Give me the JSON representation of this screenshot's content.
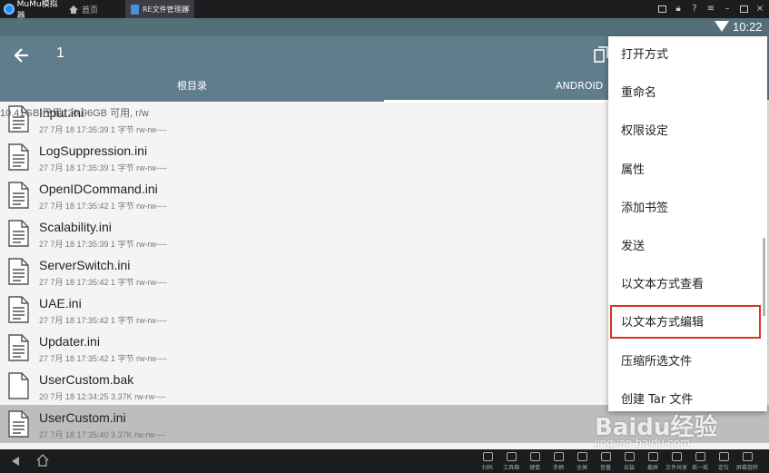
{
  "emulator": {
    "app_name": "MuMu模拟器",
    "home_tab": "首页",
    "active_tab": "RE文件管理器",
    "close_glyph": "×"
  },
  "status": {
    "time": "10:22"
  },
  "appbar": {
    "path": "1",
    "tab_root": "根目录",
    "tab_android": "ANDROID"
  },
  "storage_info": "10.41GB 已用, 20.96GB 可用, r/w",
  "files": [
    {
      "name": "Input.ini",
      "meta": "27 7月 18 17:35:39  1 字节  rw-rw----"
    },
    {
      "name": "LogSuppression.ini",
      "meta": "27 7月 18 17:35:39  1 字节  rw-rw----"
    },
    {
      "name": "OpenIDCommand.ini",
      "meta": "27 7月 18 17:35:42  1 字节  rw-rw----"
    },
    {
      "name": "Scalability.ini",
      "meta": "27 7月 18 17:35:39  1 字节  rw-rw----"
    },
    {
      "name": "ServerSwitch.ini",
      "meta": "27 7月 18 17:35:42  1 字节  rw-rw----"
    },
    {
      "name": "UAE.ini",
      "meta": "27 7月 18 17:35:42  1 字节  rw-rw----"
    },
    {
      "name": "Updater.ini",
      "meta": "27 7月 18 17:35:42  1 字节  rw-rw----"
    },
    {
      "name": "UserCustom.bak",
      "meta": "20 7月 18 12:34:25  3.37K  rw-rw----"
    },
    {
      "name": "UserCustom.ini",
      "meta": "27 7月 18 17:35:40  3.37K  rw-rw----"
    }
  ],
  "selected_file_index": 8,
  "context_menu": {
    "items": [
      "打开方式",
      "重命名",
      "权限设定",
      "属性",
      "添加书签",
      "发送",
      "以文本方式查看",
      "以文本方式编辑",
      "压缩所选文件",
      "创建 Tar 文件"
    ],
    "highlighted_index": 7,
    "highlight_color": "#d9341e"
  },
  "toolbar": {
    "labels": [
      "扫码",
      "工具箱",
      "键鼠",
      "手柄",
      "全屏",
      "音量",
      "安装",
      "截屏",
      "文件共享",
      "摇一摇",
      "定位",
      "屏幕旋转"
    ]
  },
  "watermark": {
    "brand": "Baidu经验",
    "url": "jingyan.baidu.com"
  },
  "colors": {
    "appbar": "#607d8b",
    "statusbar": "#546e7a",
    "selected_row": "#bdbdbd",
    "titlebar": "#1d1d20"
  }
}
